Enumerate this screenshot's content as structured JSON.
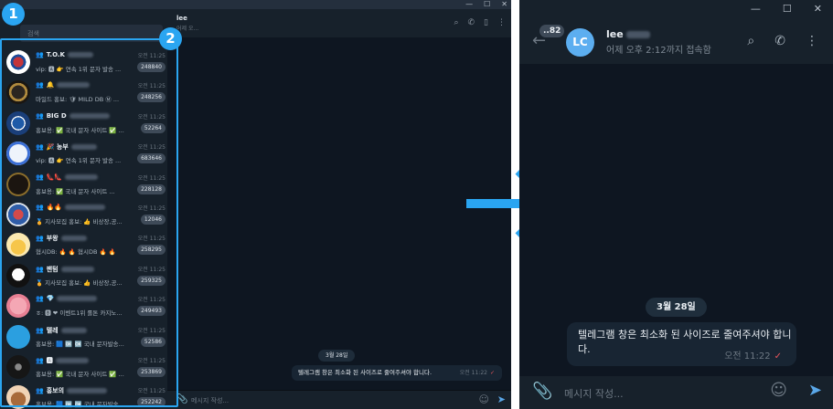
{
  "annotations": {
    "marker_1": "1",
    "marker_2": "2",
    "accent": "#2aa5f1"
  },
  "left_window": {
    "search_placeholder": "검색",
    "window_controls": [
      "—",
      "☐",
      "✕"
    ],
    "header": {
      "name": "lee",
      "status": "어제 오...",
      "icons": [
        "search-icon",
        "phone-icon",
        "sidebar-icon",
        "more-icon"
      ]
    },
    "chats": [
      {
        "name": "T.O.K",
        "time": "오전 11:25",
        "preview": "vip: 🅰 👉 연속 1위 문자 발송 ...",
        "badge": "248840",
        "avatar": "korea-flag"
      },
      {
        "name": "🔔",
        "time": "오전 11:25",
        "preview": "마일드 홍보: 🛡 MILD DB Ⓜ ...",
        "badge": "248256",
        "avatar": "gold-logo"
      },
      {
        "name": "BIG D",
        "time": "오전 11:25",
        "preview": "홍보용: ✅ 국내 문자 사이트 ✅ ...",
        "badge": "52264",
        "avatar": "blue-seal"
      },
      {
        "name": "🎉 농부",
        "time": "오전 11:25",
        "preview": "vip: 🅰 👉 연속 1위 문자 발송 ...",
        "badge": "683646",
        "avatar": "marketing-logo"
      },
      {
        "name": "👠👠",
        "time": "오전 11:25",
        "preview": "홍보용: ✅ 국내 문자 사이트 ...",
        "badge": "228128",
        "avatar": "gucci-logo"
      },
      {
        "name": "🔥🔥",
        "time": "오전 11:25",
        "preview": "🏅 지사모집 홍보: 👍 비상장,공...",
        "badge": "12046",
        "avatar": "dragon-badge"
      },
      {
        "name": "부왕",
        "time": "오전 11:25",
        "preview": "협시DB: 🔥 🔥 협시DB 🔥 🔥",
        "badge": "258295",
        "avatar": "cartoon-face"
      },
      {
        "name": "팬텀",
        "time": "오전 11:25",
        "preview": "🏅 지사모집 홍보: 👍 비상장,공...",
        "badge": "259325",
        "avatar": "ghost"
      },
      {
        "name": "💎",
        "time": "오전 11:25",
        "preview": "ㅎ: 🅱 ❤ 이벤트1위 롤톤 카지노...",
        "badge": "249493",
        "avatar": "pink-cartoon"
      },
      {
        "name": "텔레",
        "time": "오전 11:25",
        "preview": "홍보용: 🟦 🆗 🆗 국내 문자발송...",
        "badge": "52586",
        "avatar": "telegram"
      },
      {
        "name": "🅰",
        "time": "오전 11:25",
        "preview": "홍보용: ✅ 국내 문자 사이트 ✅ ...",
        "badge": "253869",
        "avatar": "dark-logo"
      },
      {
        "name": "홍보의",
        "time": "오전 11:25",
        "preview": "홍보용: 🟦 🆗 🆗 국내 문자발송...",
        "badge": "252242",
        "avatar": "brown-character"
      }
    ],
    "date_pill": "3월 28일",
    "message": {
      "text": "텔레그램 창은 최소화 된 사이즈로 줄여주셔야 합니다.",
      "time": "오전 11:22"
    },
    "input_placeholder": "메시지 작성..."
  },
  "right_window": {
    "window_controls": [
      "—",
      "☐",
      "✕"
    ],
    "unread_count": "..82",
    "avatar_initials": "LC",
    "avatar_color": "#5caef0",
    "name": "lee",
    "status": "어제 오후 2:12까지 접속함",
    "header_icons": [
      "search-icon",
      "phone-icon",
      "more-icon"
    ],
    "date_pill": "3월 28일",
    "message": {
      "text": "텔레그램 창은 최소화 된 사이즈로 줄여주셔야 합니다.",
      "time": "오전 11:22"
    },
    "input_placeholder": "메시지 작성..."
  }
}
